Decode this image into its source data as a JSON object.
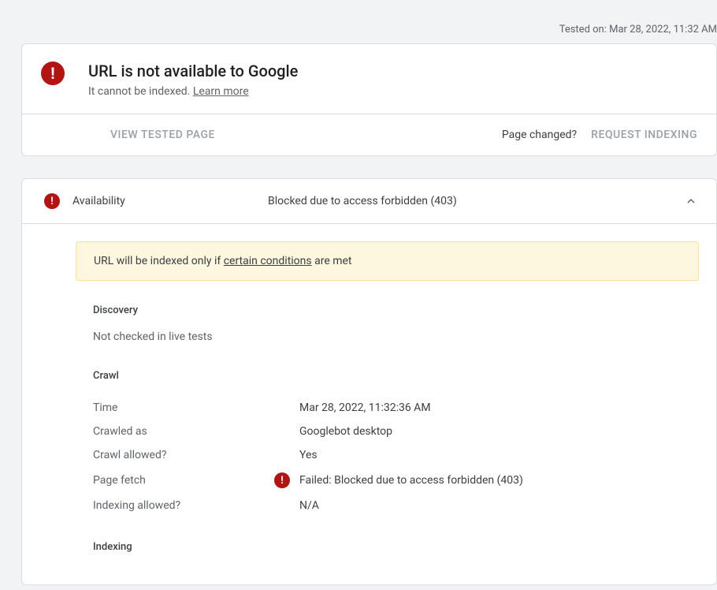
{
  "tested_on_label": "Tested on:",
  "tested_on_value": "Mar 28, 2022, 11:32 AM",
  "status": {
    "title": "URL is not available to Google",
    "subtitle_prefix": "It cannot be indexed. ",
    "learn_more": "Learn more"
  },
  "actions": {
    "view_tested_page": "VIEW TESTED PAGE",
    "page_changed": "Page changed?",
    "request_indexing": "REQUEST INDEXING"
  },
  "availability": {
    "label": "Availability",
    "status": "Blocked due to access forbidden (403)"
  },
  "warning": {
    "prefix": "URL will be indexed only if ",
    "link": "certain conditions",
    "suffix": " are met"
  },
  "discovery": {
    "heading": "Discovery",
    "text": "Not checked in live tests"
  },
  "crawl": {
    "heading": "Crawl",
    "rows": {
      "time": {
        "label": "Time",
        "value": "Mar 28, 2022, 11:32:36 AM"
      },
      "crawled_as": {
        "label": "Crawled as",
        "value": "Googlebot desktop"
      },
      "crawl_allowed": {
        "label": "Crawl allowed?",
        "value": "Yes"
      },
      "page_fetch": {
        "label": "Page fetch",
        "value": "Failed: Blocked due to access forbidden (403)",
        "error": true
      },
      "indexing_allowed": {
        "label": "Indexing allowed?",
        "value": "N/A"
      }
    }
  },
  "indexing": {
    "heading": "Indexing"
  }
}
